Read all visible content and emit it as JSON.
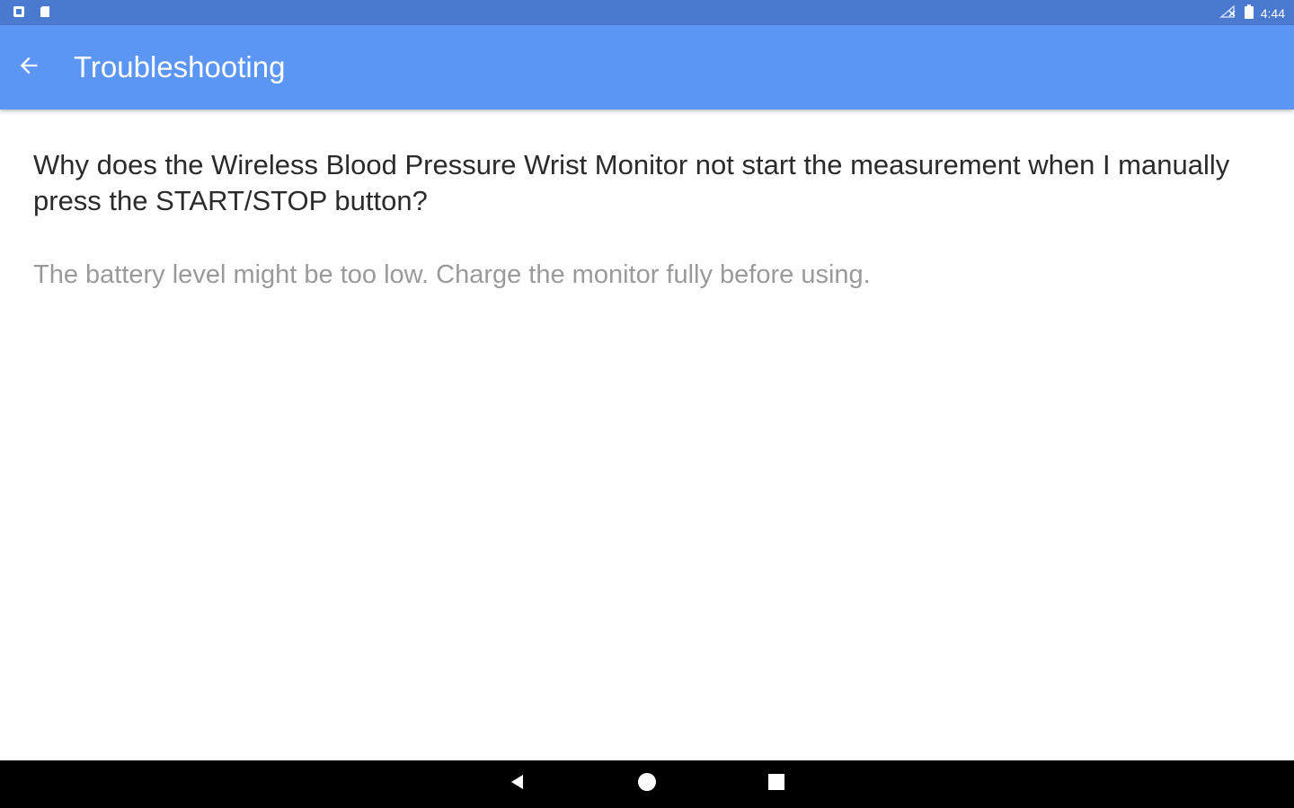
{
  "status_bar": {
    "time": "4:44",
    "left_icons": [
      "notification-icon",
      "sd-card-icon"
    ],
    "right_icons": [
      "no-signal-icon",
      "battery-icon"
    ]
  },
  "app_bar": {
    "title": "Troubleshooting",
    "back_icon": "arrow-left-icon",
    "color": "#5b96f4"
  },
  "content": {
    "question": "Why does the Wireless Blood Pressure Wrist Monitor not start the measurement when I manually press the START/STOP button?",
    "answer": "The battery level might be too low. Charge the monitor fully before using."
  },
  "nav_bar": {
    "buttons": [
      "back-triangle-icon",
      "home-circle-icon",
      "recents-square-icon"
    ]
  }
}
